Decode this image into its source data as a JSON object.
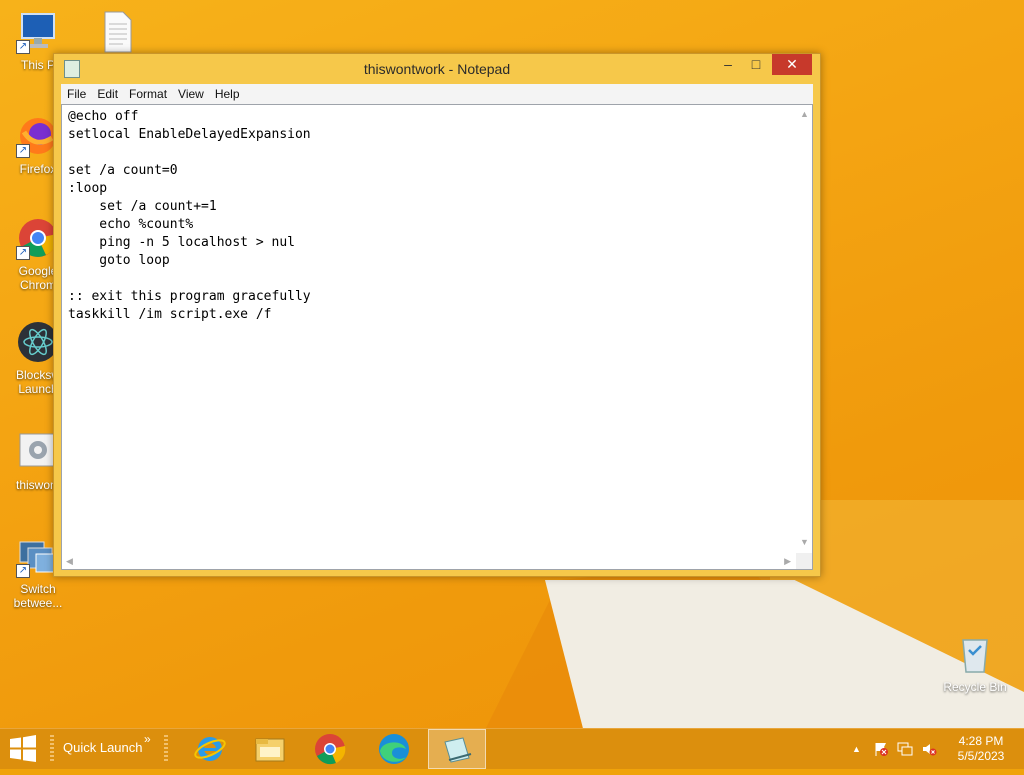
{
  "desktop": {
    "icons": [
      {
        "label": "This P",
        "icon": "this-pc-icon"
      },
      {
        "label": "",
        "icon": "text-file-icon"
      },
      {
        "label": "Firefox",
        "icon": "firefox-icon"
      },
      {
        "label": "Google Chrom",
        "icon": "chrome-icon"
      },
      {
        "label": "Blocksw Launch",
        "icon": "blocksworld-launcher-icon"
      },
      {
        "label": "thiswont",
        "icon": "batch-file-icon"
      },
      {
        "label": "Switch betwee...",
        "icon": "switch-windows-icon"
      },
      {
        "label": "Recycle Bin",
        "icon": "recycle-bin-icon"
      }
    ]
  },
  "window": {
    "title": "thiswontwork - Notepad",
    "minimize": "–",
    "maximize": "□",
    "close": "✕",
    "menu": [
      "File",
      "Edit",
      "Format",
      "View",
      "Help"
    ],
    "content": "@echo off\nsetlocal EnableDelayedExpansion\n\nset /a count=0\n:loop\n    set /a count+=1\n    echo %count%\n    ping -n 5 localhost > nul\n    goto loop\n\n:: exit this program gracefully\ntaskkill /im script.exe /f"
  },
  "taskbar": {
    "quick_launch": "Quick Launch",
    "chevron": "»",
    "apps": [
      {
        "name": "internet-explorer-icon",
        "active": false
      },
      {
        "name": "file-explorer-icon",
        "active": false
      },
      {
        "name": "chrome-icon",
        "active": false
      },
      {
        "name": "edge-icon",
        "active": false
      },
      {
        "name": "notepad-icon",
        "active": true
      }
    ],
    "tray": {
      "up": "▲",
      "time": "4:28 PM",
      "date": "5/5/2023"
    }
  },
  "colors": {
    "accent_orange": "#f4a412",
    "close_red": "#c7392b",
    "taskbar": "#dc8f0d"
  }
}
